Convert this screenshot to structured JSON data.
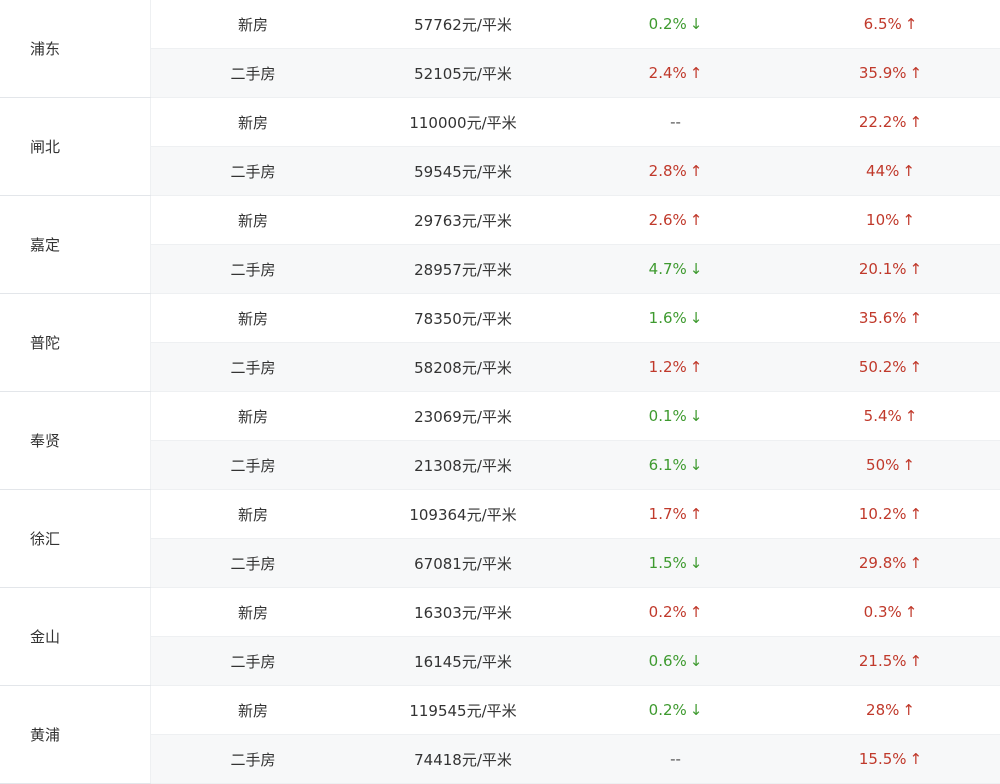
{
  "rows": [
    {
      "district": "浦东",
      "items": [
        {
          "type": "新房",
          "price": "57762元/平米",
          "mom": "0.2%",
          "mom_dir": "down",
          "yoy": "6.5%",
          "yoy_dir": "up"
        },
        {
          "type": "二手房",
          "price": "52105元/平米",
          "mom": "2.4%",
          "mom_dir": "up",
          "yoy": "35.9%",
          "yoy_dir": "up"
        }
      ]
    },
    {
      "district": "闸北",
      "items": [
        {
          "type": "新房",
          "price": "110000元/平米",
          "mom": "--",
          "mom_dir": "flat",
          "yoy": "22.2%",
          "yoy_dir": "up"
        },
        {
          "type": "二手房",
          "price": "59545元/平米",
          "mom": "2.8%",
          "mom_dir": "up",
          "yoy": "44%",
          "yoy_dir": "up"
        }
      ]
    },
    {
      "district": "嘉定",
      "items": [
        {
          "type": "新房",
          "price": "29763元/平米",
          "mom": "2.6%",
          "mom_dir": "up",
          "yoy": "10%",
          "yoy_dir": "up"
        },
        {
          "type": "二手房",
          "price": "28957元/平米",
          "mom": "4.7%",
          "mom_dir": "down",
          "yoy": "20.1%",
          "yoy_dir": "up"
        }
      ]
    },
    {
      "district": "普陀",
      "items": [
        {
          "type": "新房",
          "price": "78350元/平米",
          "mom": "1.6%",
          "mom_dir": "down",
          "yoy": "35.6%",
          "yoy_dir": "up"
        },
        {
          "type": "二手房",
          "price": "58208元/平米",
          "mom": "1.2%",
          "mom_dir": "up",
          "yoy": "50.2%",
          "yoy_dir": "up"
        }
      ]
    },
    {
      "district": "奉贤",
      "items": [
        {
          "type": "新房",
          "price": "23069元/平米",
          "mom": "0.1%",
          "mom_dir": "down",
          "yoy": "5.4%",
          "yoy_dir": "up"
        },
        {
          "type": "二手房",
          "price": "21308元/平米",
          "mom": "6.1%",
          "mom_dir": "down",
          "yoy": "50%",
          "yoy_dir": "up"
        }
      ]
    },
    {
      "district": "徐汇",
      "items": [
        {
          "type": "新房",
          "price": "109364元/平米",
          "mom": "1.7%",
          "mom_dir": "up",
          "yoy": "10.2%",
          "yoy_dir": "up"
        },
        {
          "type": "二手房",
          "price": "67081元/平米",
          "mom": "1.5%",
          "mom_dir": "down",
          "yoy": "29.8%",
          "yoy_dir": "up"
        }
      ]
    },
    {
      "district": "金山",
      "items": [
        {
          "type": "新房",
          "price": "16303元/平米",
          "mom": "0.2%",
          "mom_dir": "up",
          "yoy": "0.3%",
          "yoy_dir": "up"
        },
        {
          "type": "二手房",
          "price": "16145元/平米",
          "mom": "0.6%",
          "mom_dir": "down",
          "yoy": "21.5%",
          "yoy_dir": "up"
        }
      ]
    },
    {
      "district": "黄浦",
      "items": [
        {
          "type": "新房",
          "price": "119545元/平米",
          "mom": "0.2%",
          "mom_dir": "down",
          "yoy": "28%",
          "yoy_dir": "up"
        },
        {
          "type": "二手房",
          "price": "74418元/平米",
          "mom": "--",
          "mom_dir": "flat",
          "yoy": "15.5%",
          "yoy_dir": "up"
        }
      ]
    }
  ],
  "arrows": {
    "up": "↑",
    "down": "↓",
    "flat": ""
  },
  "colors": {
    "up": "#c0392b",
    "down": "#3e9a2f"
  }
}
